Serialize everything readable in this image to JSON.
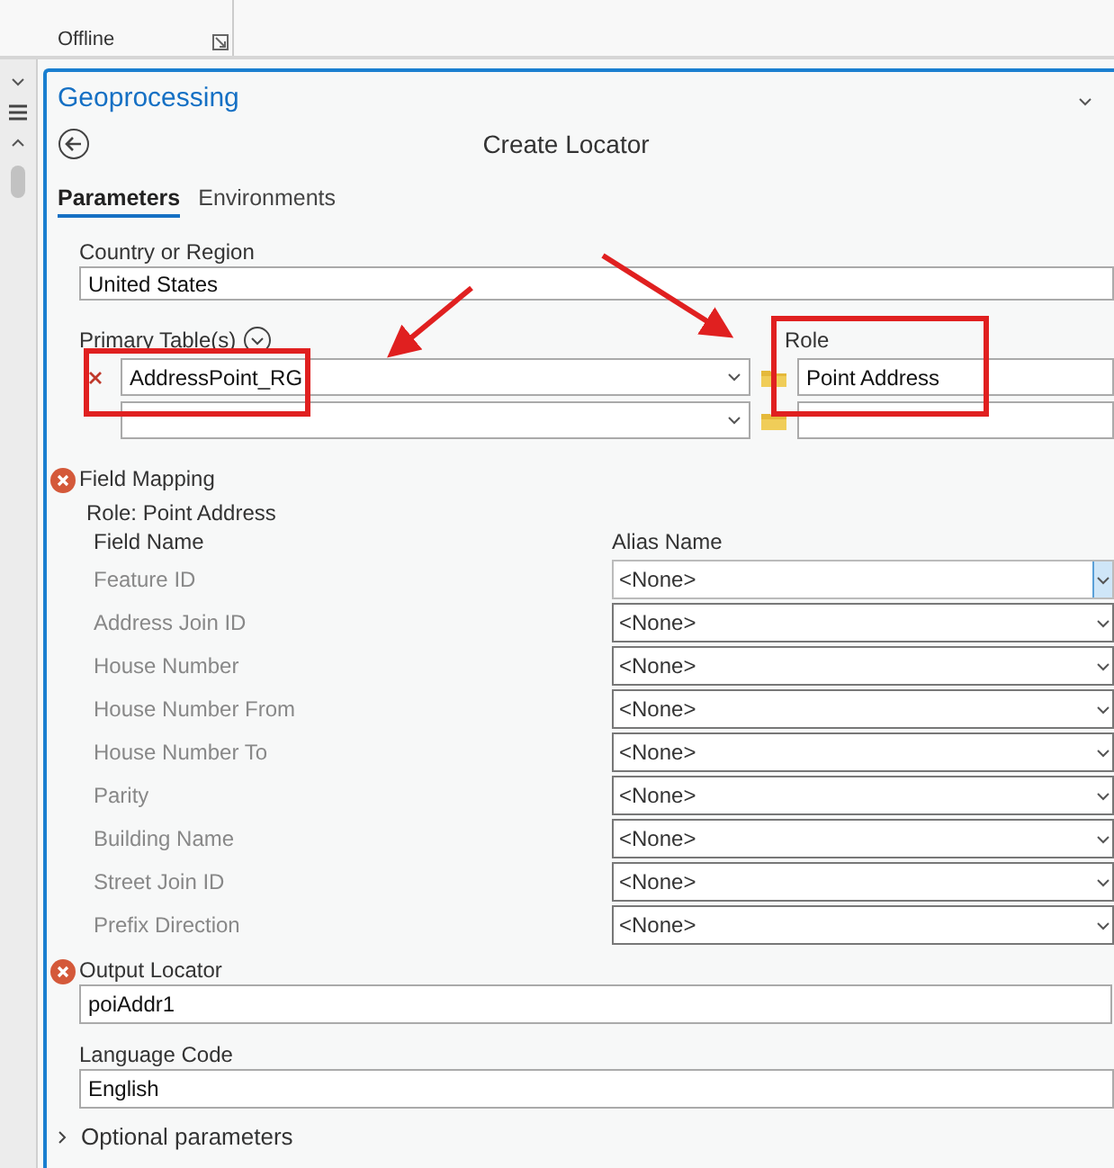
{
  "ribbon": {
    "group_label": "Offline"
  },
  "panel": {
    "title": "Geoprocessing",
    "tool_title": "Create Locator"
  },
  "tabs": [
    {
      "label": "Parameters",
      "selected": true
    },
    {
      "label": "Environments",
      "selected": false
    }
  ],
  "country": {
    "label": "Country or Region",
    "value": "United States"
  },
  "primary_tables": {
    "label": "Primary Table(s)",
    "role_label": "Role",
    "rows": [
      {
        "table": "AddressPoint_RG",
        "role": "Point Address",
        "removable": true
      },
      {
        "table": "",
        "role": "",
        "removable": false
      }
    ]
  },
  "field_mapping": {
    "label": "Field Mapping",
    "error": true,
    "role_caption": "Role: Point Address",
    "col_field": "Field Name",
    "col_alias": "Alias Name",
    "rows": [
      {
        "field": "Feature ID",
        "alias": "<None>",
        "focused": true
      },
      {
        "field": "Address Join ID",
        "alias": "<None>",
        "focused": false
      },
      {
        "field": "House Number",
        "alias": "<None>",
        "focused": false
      },
      {
        "field": "House Number From",
        "alias": "<None>",
        "focused": false
      },
      {
        "field": "House Number To",
        "alias": "<None>",
        "focused": false
      },
      {
        "field": "Parity",
        "alias": "<None>",
        "focused": false
      },
      {
        "field": "Building Name",
        "alias": "<None>",
        "focused": false
      },
      {
        "field": "Street Join ID",
        "alias": "<None>",
        "focused": false
      },
      {
        "field": "Prefix Direction",
        "alias": "<None>",
        "focused": false
      }
    ]
  },
  "output_locator": {
    "label": "Output Locator",
    "error": true,
    "value": "poiAddr1"
  },
  "language_code": {
    "label": "Language Code",
    "value": "English"
  },
  "optional_parameters": {
    "label": "Optional parameters",
    "expanded": false
  }
}
